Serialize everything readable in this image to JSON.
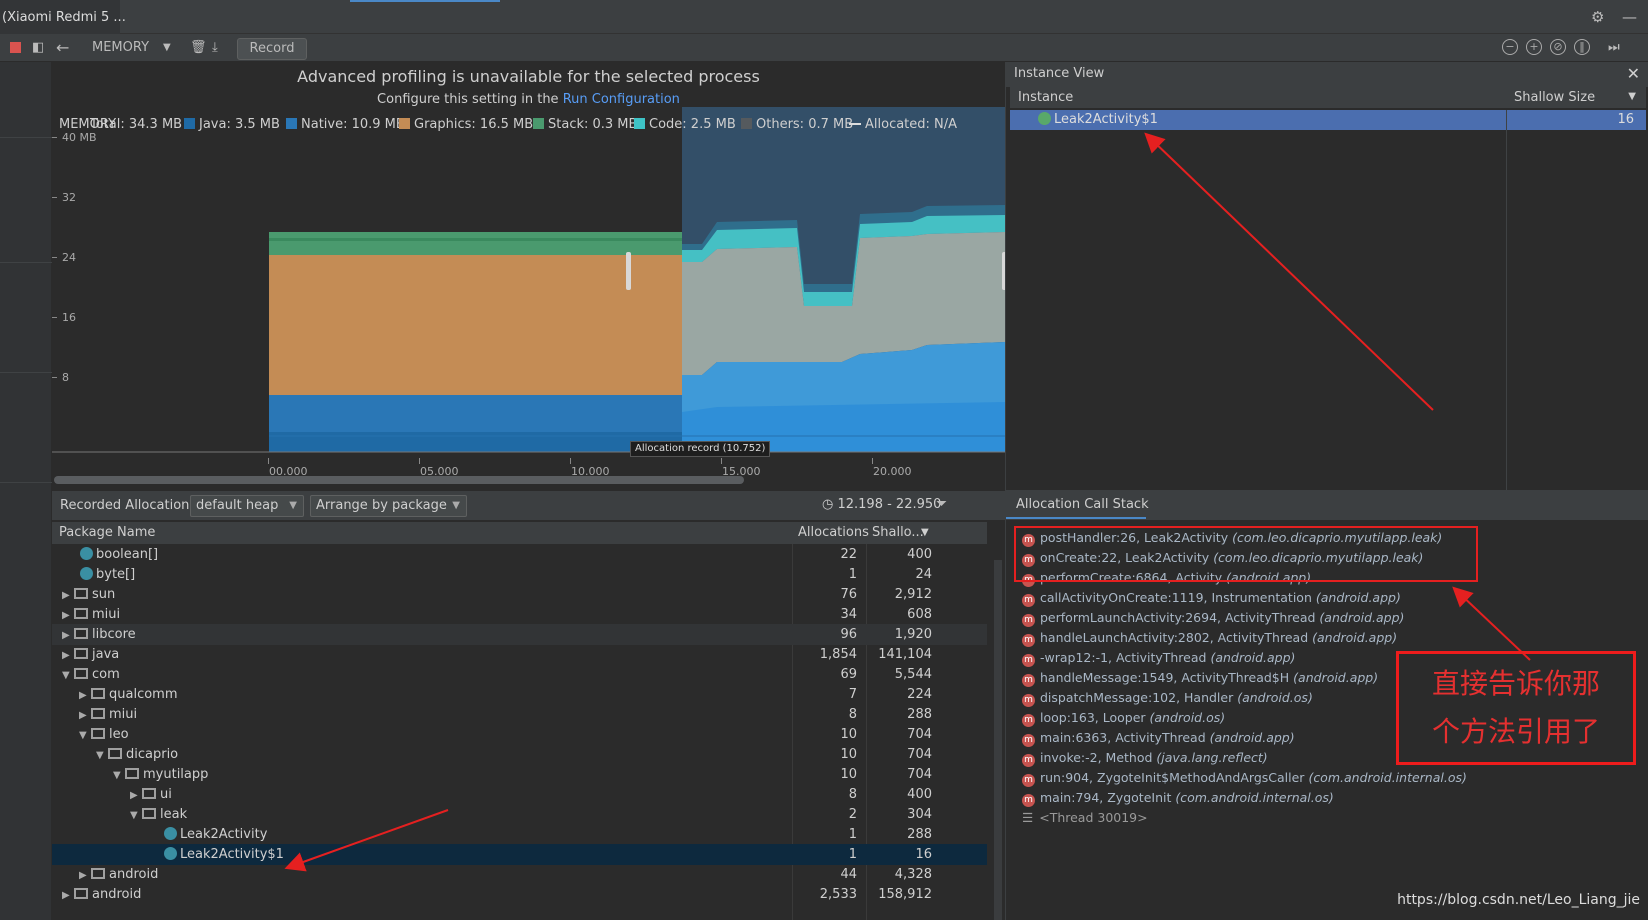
{
  "titlebar": {
    "device": "(Xiaomi Redmi 5 ..."
  },
  "toolbar": {
    "profiler": "MEMORY",
    "record_label": "Record"
  },
  "timeline": {
    "banner_title": "Advanced profiling is unavailable for the selected process",
    "banner_text": "Configure this setting in the",
    "banner_link": "Run Configuration",
    "memory_label": "MEMORY",
    "total": "Total: 34.3 MB",
    "legend": [
      {
        "label": "Java: 3.5 MB",
        "color": "#1f6aa5"
      },
      {
        "label": "Native: 10.9 MB",
        "color": "#2a77b6"
      },
      {
        "label": "Graphics: 16.5 MB",
        "color": "#c48c55"
      },
      {
        "label": "Stack: 0.3 MB",
        "color": "#4a9a6e"
      },
      {
        "label": "Code: 2.5 MB",
        "color": "#3ec3c6"
      },
      {
        "label": "Others: 0.7 MB",
        "color": "#555a5e"
      },
      {
        "label": "Allocated: N/A",
        "color": "#dddddd"
      }
    ],
    "y_labels": [
      "40 MB",
      "32",
      "24",
      "16",
      "8"
    ],
    "x_labels": [
      "00.000",
      "05.000",
      "10.000",
      "15.000",
      "20.000"
    ],
    "tooltip": "Allocation record (10.752)"
  },
  "instance_view": {
    "title": "Instance View",
    "col_instance": "Instance",
    "col_shallow": "Shallow Size",
    "row": {
      "name": "Leak2Activity$1",
      "size": "16"
    }
  },
  "alloc_bar": {
    "label": "Recorded Allocations",
    "heap": "default heap",
    "arrange": "Arrange by package",
    "range": "12.198 - 22.950"
  },
  "table": {
    "col_name": "Package Name",
    "col_alloc": "Allocations",
    "col_shallow": "Shallo...",
    "rows": [
      {
        "name": "boolean[]",
        "alloc": "22",
        "size": "400"
      },
      {
        "name": "byte[]",
        "alloc": "1",
        "size": "24"
      },
      {
        "name": "sun",
        "alloc": "76",
        "size": "2,912"
      },
      {
        "name": "miui",
        "alloc": "34",
        "size": "608"
      },
      {
        "name": "libcore",
        "alloc": "96",
        "size": "1,920"
      },
      {
        "name": "java",
        "alloc": "1,854",
        "size": "141,104"
      },
      {
        "name": "com",
        "alloc": "69",
        "size": "5,544"
      },
      {
        "name": "qualcomm",
        "alloc": "7",
        "size": "224"
      },
      {
        "name": "miui",
        "alloc": "8",
        "size": "288"
      },
      {
        "name": "leo",
        "alloc": "10",
        "size": "704"
      },
      {
        "name": "dicaprio",
        "alloc": "10",
        "size": "704"
      },
      {
        "name": "myutilapp",
        "alloc": "10",
        "size": "704"
      },
      {
        "name": "ui",
        "alloc": "8",
        "size": "400"
      },
      {
        "name": "leak",
        "alloc": "2",
        "size": "304"
      },
      {
        "name": "Leak2Activity",
        "alloc": "1",
        "size": "288"
      },
      {
        "name": "Leak2Activity$1",
        "alloc": "1",
        "size": "16"
      },
      {
        "name": "android",
        "alloc": "44",
        "size": "4,328"
      },
      {
        "name": "android",
        "alloc": "2,533",
        "size": "158,912"
      }
    ]
  },
  "callstack": {
    "title": "Allocation Call Stack",
    "frames": [
      {
        "method": "postHandler:26, Leak2Activity",
        "pkg": "(com.leo.dicaprio.myutilapp.leak)"
      },
      {
        "method": "onCreate:22, Leak2Activity",
        "pkg": "(com.leo.dicaprio.myutilapp.leak)"
      },
      {
        "method": "performCreate:6864, Activity",
        "pkg": "(android.app)"
      },
      {
        "method": "callActivityOnCreate:1119, Instrumentation",
        "pkg": "(android.app)"
      },
      {
        "method": "performLaunchActivity:2694, ActivityThread",
        "pkg": "(android.app)"
      },
      {
        "method": "handleLaunchActivity:2802, ActivityThread",
        "pkg": "(android.app)"
      },
      {
        "method": "-wrap12:-1, ActivityThread",
        "pkg": "(android.app)"
      },
      {
        "method": "handleMessage:1549, ActivityThread$H",
        "pkg": "(android.app)"
      },
      {
        "method": "dispatchMessage:102, Handler",
        "pkg": "(android.os)"
      },
      {
        "method": "loop:163, Looper",
        "pkg": "(android.os)"
      },
      {
        "method": "main:6363, ActivityThread",
        "pkg": "(android.app)"
      },
      {
        "method": "invoke:-2, Method",
        "pkg": "(java.lang.reflect)"
      },
      {
        "method": "run:904, ZygoteInit$MethodAndArgsCaller",
        "pkg": "(com.android.internal.os)"
      },
      {
        "method": "main:794, ZygoteInit",
        "pkg": "(com.android.internal.os)"
      }
    ],
    "thread": "<Thread 30019>"
  },
  "annotation": {
    "line1": "直接告诉你那",
    "line2": "个方法引用了"
  },
  "watermark": "https://blog.csdn.net/Leo_Liang_jie"
}
